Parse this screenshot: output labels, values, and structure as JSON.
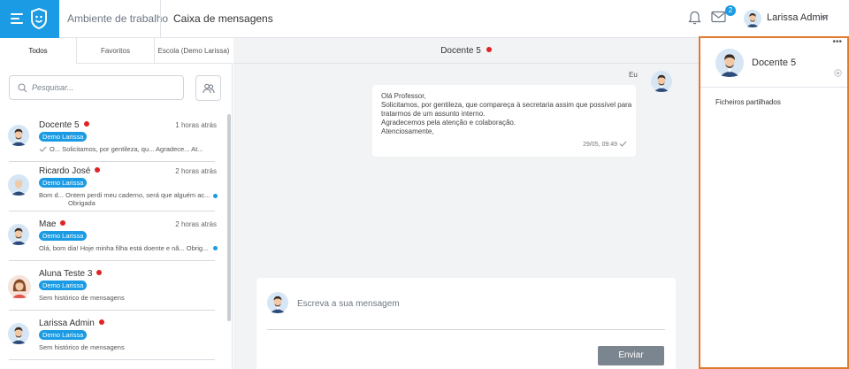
{
  "topbar": {
    "workspace_link": "Ambiente de trabalho",
    "inbox_link": "Caixa de mensagens",
    "mail_badge_count": "2",
    "user_name": "Larissa Admin",
    "brand_color": "#1a9be3",
    "icons": [
      "menu-icon",
      "app-logo-icon",
      "bell-icon",
      "mail-icon",
      "chevron-down-icon"
    ]
  },
  "left_panel": {
    "tabs": [
      {
        "label": "Todos",
        "active": true
      },
      {
        "label": "Favoritos",
        "active": false
      },
      {
        "label": "Escola (Demo Larissa)",
        "active": false
      }
    ],
    "search_placeholder": "Pesquisar...",
    "conversations": [
      {
        "name": "Docente 5",
        "time": "1 horas atrás",
        "tag": "Demo Larissa",
        "preview_1": "O...  Solicitamos, por gentileza, qu...  Agradece...  At...",
        "preview_2": "",
        "online": true,
        "unread": false
      },
      {
        "name": "Ricardo José",
        "time": "2 horas atrás",
        "tag": "Demo Larissa",
        "preview_1": "Bom d...  Ontem perdi meu caderno, será que alguém ac...",
        "preview_2": "Obrigada",
        "online": true,
        "unread": true
      },
      {
        "name": "Mae",
        "time": "2 horas atrás",
        "tag": "Demo Larissa",
        "preview_1": "Olá, bom dia! Hoje minha filha está doente e nã...   Obrig...",
        "preview_2": "",
        "online": true,
        "unread": true
      },
      {
        "name": "Aluna Teste 3",
        "time": "",
        "tag": "Demo Larissa",
        "preview_1": "Sem histórico de mensagens",
        "preview_2": "",
        "online": true,
        "unread": false
      },
      {
        "name": "Larissa Admin",
        "time": "",
        "tag": "Demo Larissa",
        "preview_1": "Sem histórico de mensagens",
        "preview_2": "",
        "online": true,
        "unread": false
      }
    ]
  },
  "chat": {
    "header_name": "Docente 5",
    "me_label": "Eu",
    "message_lines": [
      "Olá Professor,",
      "Solicitamos, por gentileza, que compareça à secretaria assim que possível para",
      "tratarmos de um assunto interno.",
      "Agradecemos pela atenção e colaboração.",
      "Atenciosamente,"
    ],
    "message_time": "29/05, 09:49",
    "composer_placeholder": "Escreva a sua mensagem",
    "send_label": "Enviar"
  },
  "right_panel": {
    "more_label": "•••",
    "contact_name": "Docente 5",
    "files_label": "Ficheiros partilhados",
    "highlight_color": "#e07a2e"
  }
}
